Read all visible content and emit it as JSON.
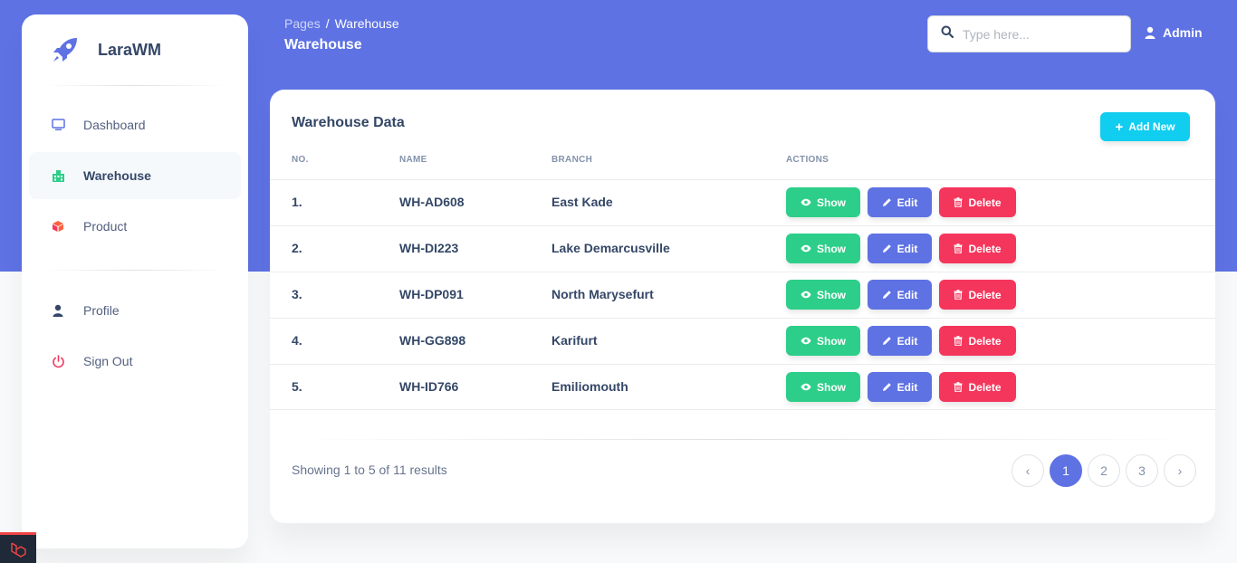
{
  "app": {
    "brand_name": "LaraWM",
    "accent_color": "#5e72e4"
  },
  "sidebar": {
    "items": [
      {
        "label": "Dashboard",
        "icon": "monitor-icon",
        "color": "#5e72e4"
      },
      {
        "label": "Warehouse",
        "icon": "warehouse-icon",
        "color": "#2dce89"
      },
      {
        "label": "Product",
        "icon": "box-icon",
        "color": "#fb6340"
      }
    ],
    "account_items": [
      {
        "label": "Profile",
        "icon": "user-icon",
        "color": "#344767"
      },
      {
        "label": "Sign Out",
        "icon": "power-icon",
        "color": "#f5365c"
      }
    ]
  },
  "header": {
    "breadcrumb_root": "Pages",
    "breadcrumb_separator": "/",
    "breadcrumb_current": "Warehouse",
    "page_title": "Warehouse",
    "search_placeholder": "Type here...",
    "user_label": "Admin"
  },
  "card": {
    "title": "Warehouse Data",
    "add_label": "Add New",
    "columns": [
      "No.",
      "Name",
      "Branch",
      "Actions"
    ],
    "rows": [
      {
        "no": "1.",
        "name": "WH-AD608",
        "branch": "East Kade"
      },
      {
        "no": "2.",
        "name": "WH-DI223",
        "branch": "Lake Demarcusville"
      },
      {
        "no": "3.",
        "name": "WH-DP091",
        "branch": "North Marysefurt"
      },
      {
        "no": "4.",
        "name": "WH-GG898",
        "branch": "Karifurt"
      },
      {
        "no": "5.",
        "name": "WH-ID766",
        "branch": "Emiliomouth"
      }
    ],
    "actions": {
      "show": "Show",
      "edit": "Edit",
      "delete": "Delete"
    },
    "summary": "Showing 1 to 5 of 11 results",
    "pagination": {
      "prev": "‹",
      "pages": [
        "1",
        "2",
        "3"
      ],
      "next": "›",
      "current": "1"
    }
  }
}
